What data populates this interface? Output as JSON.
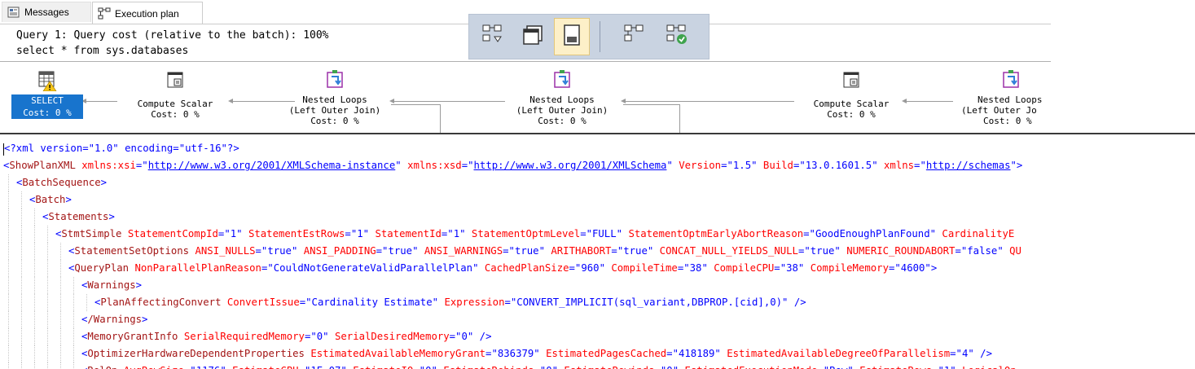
{
  "tabs": {
    "messages": {
      "label": "Messages",
      "icon": "messages-icon"
    },
    "execution_plan": {
      "label": "Execution plan",
      "icon": "execution-plan-icon"
    }
  },
  "query": {
    "line1": "Query 1: Query cost (relative to the batch): 100%",
    "line2": "select * from sys.databases"
  },
  "toolbar": {
    "buttons": [
      {
        "icon": "show-plan-icon"
      },
      {
        "icon": "window-icon"
      },
      {
        "icon": "properties-icon",
        "active": true
      },
      {
        "icon": "compare-plan-icon"
      },
      {
        "icon": "analyze-plan-icon"
      }
    ]
  },
  "plan": {
    "nodes": [
      {
        "op": "SELECT",
        "cost": "Cost: 0 %",
        "icon": "select-warning-icon",
        "selected": true
      },
      {
        "op": "Compute Scalar",
        "cost": "Cost: 0 %",
        "icon": "compute-scalar-icon"
      },
      {
        "op": "Nested Loops",
        "sub": "(Left Outer Join)",
        "cost": "Cost: 0 %",
        "icon": "nested-loops-icon"
      },
      {
        "op": "Nested Loops",
        "sub": "(Left Outer Join)",
        "cost": "Cost: 0 %",
        "icon": "nested-loops-icon"
      },
      {
        "op": "Compute Scalar",
        "cost": "Cost: 0 %",
        "icon": "compute-scalar-icon"
      },
      {
        "op": "Nested Loops",
        "sub": "(Left Outer Jo",
        "cost": "Cost: 0 %",
        "icon": "nested-loops-icon"
      }
    ]
  },
  "xml": {
    "decl": "<?xml version=\"1.0\" encoding=\"utf-16\"?>",
    "lines": [
      {
        "indent": 0,
        "tag": "ShowPlanXML",
        "attrs": [
          [
            "xmlns:xsi",
            "http://www.w3.org/2001/XMLSchema-instance",
            true
          ],
          [
            "xmlns:xsd",
            "http://www.w3.org/2001/XMLSchema",
            true
          ],
          [
            "Version",
            "1.5",
            false
          ],
          [
            "Build",
            "13.0.1601.5",
            false
          ],
          [
            "xmlns",
            "http://schemas",
            true
          ]
        ],
        "close": ">",
        "cut": true
      },
      {
        "indent": 1,
        "tag": "BatchSequence",
        "attrs": [],
        "close": ">"
      },
      {
        "indent": 2,
        "tag": "Batch",
        "attrs": [],
        "close": ">"
      },
      {
        "indent": 3,
        "tag": "Statements",
        "attrs": [],
        "close": ">"
      },
      {
        "indent": 4,
        "tag": "StmtSimple",
        "attrs": [
          [
            "StatementCompId",
            "1",
            false
          ],
          [
            "StatementEstRows",
            "1",
            false
          ],
          [
            "StatementId",
            "1",
            false
          ],
          [
            "StatementOptmLevel",
            "FULL",
            false
          ],
          [
            "StatementOptmEarlyAbortReason",
            "GoodEnoughPlanFound",
            false
          ]
        ],
        "tail": " CardinalityE",
        "close": ""
      },
      {
        "indent": 5,
        "tag": "StatementSetOptions",
        "attrs": [
          [
            "ANSI_NULLS",
            "true",
            false
          ],
          [
            "ANSI_PADDING",
            "true",
            false
          ],
          [
            "ANSI_WARNINGS",
            "true",
            false
          ],
          [
            "ARITHABORT",
            "true",
            false
          ],
          [
            "CONCAT_NULL_YIELDS_NULL",
            "true",
            false
          ],
          [
            "NUMERIC_ROUNDABORT",
            "false",
            false
          ]
        ],
        "tail": " QU",
        "close": ""
      },
      {
        "indent": 5,
        "tag": "QueryPlan",
        "attrs": [
          [
            "NonParallelPlanReason",
            "CouldNotGenerateValidParallelPlan",
            false
          ],
          [
            "CachedPlanSize",
            "960",
            false
          ],
          [
            "CompileTime",
            "38",
            false
          ],
          [
            "CompileCPU",
            "38",
            false
          ],
          [
            "CompileMemory",
            "4600",
            false
          ]
        ],
        "close": ">"
      },
      {
        "indent": 6,
        "tag": "Warnings",
        "attrs": [],
        "close": ">"
      },
      {
        "indent": 7,
        "tag": "PlanAffectingConvert",
        "attrs": [
          [
            "ConvertIssue",
            "Cardinality Estimate",
            false
          ],
          [
            "Expression",
            "CONVERT_IMPLICIT(sql_variant,DBPROP.[cid],0)",
            false
          ]
        ],
        "close": " />"
      },
      {
        "indent": 6,
        "tag": "/Warnings",
        "attrs": [],
        "close": ">"
      },
      {
        "indent": 6,
        "tag": "MemoryGrantInfo",
        "attrs": [
          [
            "SerialRequiredMemory",
            "0",
            false
          ],
          [
            "SerialDesiredMemory",
            "0",
            false
          ]
        ],
        "close": " />"
      },
      {
        "indent": 6,
        "tag": "OptimizerHardwareDependentProperties",
        "attrs": [
          [
            "EstimatedAvailableMemoryGrant",
            "836379",
            false
          ],
          [
            "EstimatedPagesCached",
            "418189",
            false
          ],
          [
            "EstimatedAvailableDegreeOfParallelism",
            "4",
            false
          ]
        ],
        "close": " />"
      },
      {
        "indent": 6,
        "tag": "RelOp",
        "attrs": [
          [
            "AvgRowSize",
            "1176",
            false
          ],
          [
            "EstimateCPU",
            "1E-07",
            false
          ],
          [
            "EstimateIO",
            "0",
            false
          ],
          [
            "EstimateRebinds",
            "0",
            false
          ],
          [
            "EstimateRewinds",
            "0",
            false
          ],
          [
            "EstimatedExecutionMode",
            "Row",
            false
          ],
          [
            "EstimateRows",
            "1",
            false
          ]
        ],
        "tail": " LogicalOp=",
        "close": ""
      }
    ]
  }
}
